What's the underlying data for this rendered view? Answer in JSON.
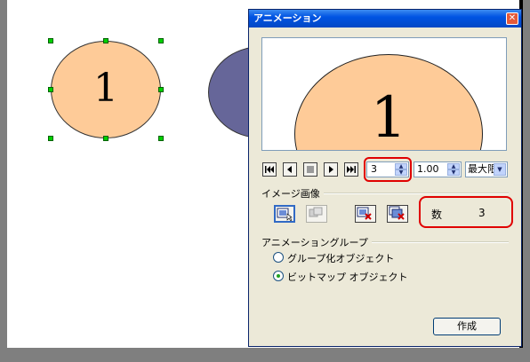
{
  "document": {
    "ellipse1_label": "1"
  },
  "dialog": {
    "title": "アニメーション",
    "close_label": "✕",
    "preview_label": "1",
    "playback": {
      "first_icon": "skip-to-first-icon",
      "prev_icon": "step-back-icon",
      "stop_icon": "stop-icon",
      "play_icon": "play-icon",
      "last_icon": "skip-to-last-icon",
      "frame_value": "3",
      "speed_value": "1.00",
      "size_value": "最大限"
    },
    "image_group": {
      "label": "イメージ画像",
      "count_label": "数",
      "count_value": "3"
    },
    "anim_group": {
      "label": "アニメーショングループ",
      "options": [
        {
          "label": "グループ化オブジェクト",
          "selected": false
        },
        {
          "label": "ビットマップ オブジェクト",
          "selected": true
        }
      ]
    },
    "create_label": "作成"
  },
  "colors": {
    "ellipse_fill": "#fecb98",
    "ellipse2_fill": "#666699",
    "highlight": "#e00000",
    "titlebar": "#0054e3"
  }
}
